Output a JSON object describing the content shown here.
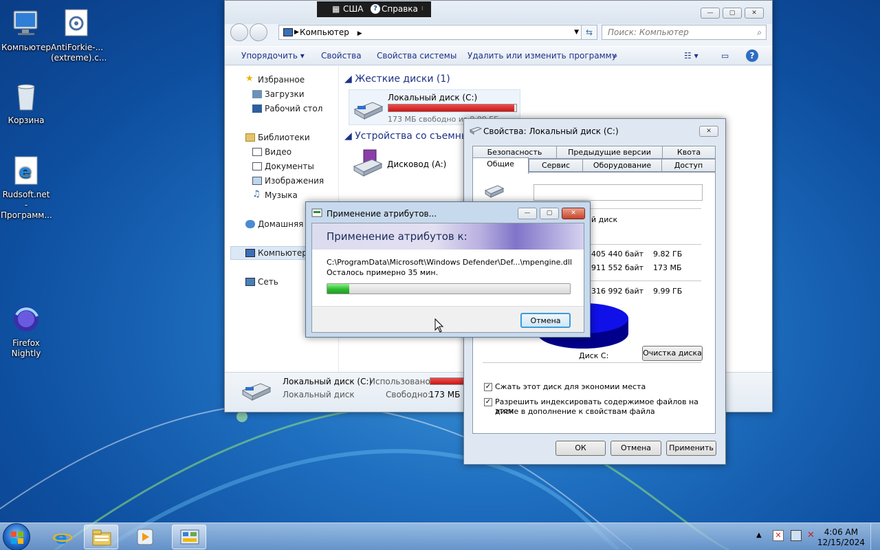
{
  "desktop": {
    "icons": [
      {
        "label": "Компьютер"
      },
      {
        "label": "AntiForkie-... (extreme).c..."
      },
      {
        "label": "Корзина"
      },
      {
        "label": "Rudsoft.net - Программ..."
      },
      {
        "label": "Firefox Nightly"
      }
    ]
  },
  "langbar": {
    "lang": "США",
    "help": "Справка"
  },
  "explorer": {
    "address": "Компьютер",
    "search_placeholder": "Поиск: Компьютер",
    "cmd": [
      "Упорядочить",
      "Свойства",
      "Свойства системы",
      "Удалить или изменить программу",
      "»"
    ],
    "nav": {
      "favorites": "Избранное",
      "downloads": "Загрузки",
      "desktop": "Рабочий стол",
      "libraries": "Библиотеки",
      "video": "Видео",
      "documents": "Документы",
      "images": "Изображения",
      "music": "Музыка",
      "homegroup": "Домашняя гр",
      "computer": "Компьютер",
      "network": "Сеть"
    },
    "groups": {
      "hdd": "Жесткие диски (1)",
      "removable": "Устройства со съемны"
    },
    "drive_c": {
      "name": "Локальный диск (C:)",
      "free": "173 МБ свободно из 9,99 ГБ",
      "used_fraction": 0.983
    },
    "drive_a": {
      "name": "Дисковод (A:)"
    },
    "details": {
      "name": "Локальный диск (C:)",
      "type": "Локальный диск",
      "used_label": "Использовано:",
      "free_label": "Свободно:",
      "free_value": "173 МБ"
    }
  },
  "props": {
    "title": "Свойства: Локальный диск (C:)",
    "tabs_row1": [
      "Безопасность",
      "Предыдущие версии",
      "Квота"
    ],
    "tabs_row2": [
      "Общие",
      "Сервис",
      "Оборудование",
      "Доступ"
    ],
    "type_fragment": "й диск",
    "used_bytes": "405 440 байт",
    "used_gb": "9.82 ГБ",
    "free_bytes": "911 552 байт",
    "free_mb": "173 МБ",
    "total_bytes": "316 992 байт",
    "total_gb": "9.99 ГБ",
    "disk_label": "Диск C:",
    "cleanup": "Очистка диска",
    "compress": "Сжать этот диск для экономии места",
    "index_line1": "Разрешить индексировать содержимое файлов на этом",
    "index_line2": "диске в дополнение к свойствам файла",
    "ok": "ОК",
    "cancel": "Отмена",
    "apply": "Применить"
  },
  "apply_dialog": {
    "title": "Применение атрибутов...",
    "heading": "Применение атрибутов к:",
    "path": "C:\\ProgramData\\Microsoft\\Windows Defender\\Def...\\mpengine.dll",
    "remaining": "Осталось примерно 35 мин.",
    "progress": 0.09,
    "cancel": "Отмена"
  },
  "taskbar": {
    "time": "4:06 AM",
    "date": "12/15/2024"
  }
}
